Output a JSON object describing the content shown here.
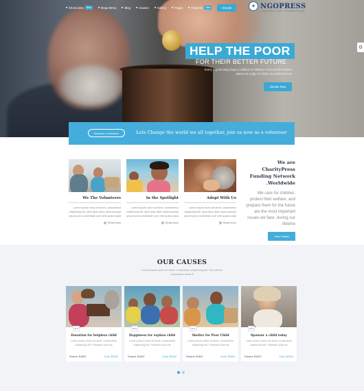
{
  "nav": {
    "items": [
      {
        "label": "Shortcodes",
        "badge": "New"
      },
      {
        "label": "Mega Menu",
        "badge": ""
      },
      {
        "label": "Blog",
        "badge": ""
      },
      {
        "label": "Causes",
        "badge": ""
      },
      {
        "label": "Gallery",
        "badge": ""
      },
      {
        "label": "Pages",
        "badge": ""
      },
      {
        "label": "Features",
        "badge": "New"
      }
    ],
    "cta": "Donate"
  },
  "brand": {
    "name": "NGOPRESS",
    "tagline": "FUNDRAISING & CHARITY WORDPRESS THEME"
  },
  "hero": {
    "title": "HELP THE POOR",
    "subtitle": "FOR THEIR BETTER FUTURE",
    "text": "Every day we bring hope to millions of children in the world's hardest places as a sign of God's unconditional love",
    "button": "Donate Now"
  },
  "band": {
    "button": "Become a Volunteer",
    "text": "Lets Change the world we all together, join us now as a volunteer"
  },
  "features": [
    {
      "title": "We The Volunteers",
      "text": "Lorem ipsum dolor sit amet, consectetur adipiscing elit. Quis ipsa ullam dicta suscipit ipsum porro molestiae cum nihil quasi culpa",
      "more": "Read more"
    },
    {
      "title": "In the Spotlight",
      "text": "Lorem ipsum dolor sit amet, consectetur adipiscing elit. Quis ipsa ullam dicta suscipit ipsum porro molestiae cum nihil quasi culpa",
      "more": "Read more"
    },
    {
      "title": "Adopt With Us",
      "text": "Lorem ipsum dolor sit amet, consectetur adipiscing elit. Quis ipsa ullam dicta suscipit ipsum porro molestiae cum nihil quasi culpa",
      "more": "Read more"
    }
  ],
  "about": {
    "title": "We are CharityPress Funding Network .Worldwide",
    "text": "We care for children, protect their welfare, and prepare them for the future are the most important issues we face .during our lifetime",
    "button": "View Details"
  },
  "causes": {
    "title": "OUR CAUSES",
    "intro": "Lorem ipsum dolor sit amet, consectetur adipiscing elit. Non autem voluptatem obvenit",
    "cards": [
      {
        "badge": "50%",
        "title": "Donation for helpless child",
        "text": "Lorem ipsum dolor sit amet, consectetur adipiscing elit. Praesent quis est",
        "raised": "Raised: $1800",
        "goal": "Goal: $2500"
      },
      {
        "badge": "50%",
        "title": "Happiness for orphan child",
        "text": "Lorem ipsum dolor sit amet, consectetur adipiscing elit. Praesent quis est",
        "raised": "Raised: $1800",
        "goal": "Goal: $2500"
      },
      {
        "badge": "50%",
        "title": "Shelter for Poor Child",
        "text": "Lorem ipsum dolor sit amet, consectetur adipiscing elit. Praesent quis est",
        "raised": "Raised: $1800",
        "goal": "Goal: $2500"
      },
      {
        "badge": "50%",
        "title": "Sponsor a child today",
        "text": "Lorem ipsum dolor sit amet, consectetur adipiscing elit. Praesent quis est",
        "raised": "Raised: $1800",
        "goal": "Goal: $2500"
      }
    ]
  },
  "colors": {
    "accent": "#3aa9d6",
    "band": "#45addb",
    "causes_bg": "#f1f3f6",
    "heading": "#2b2f35"
  }
}
